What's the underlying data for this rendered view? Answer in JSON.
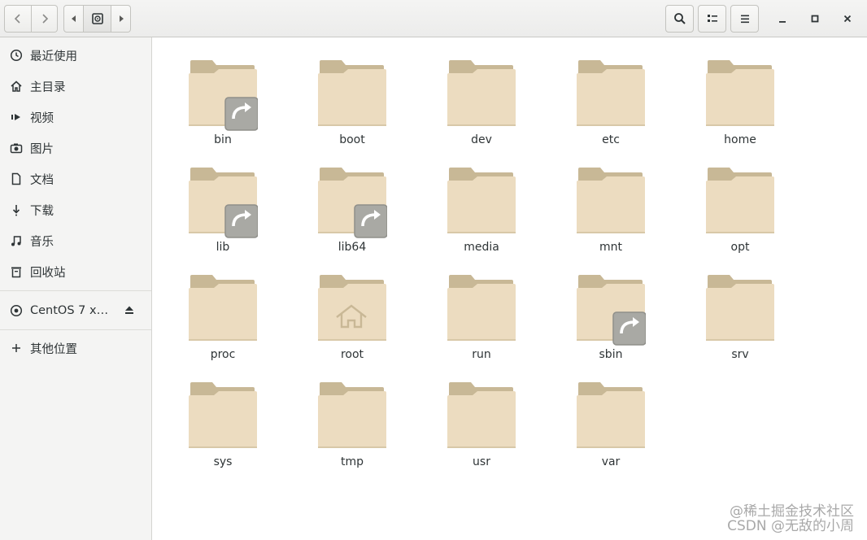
{
  "sidebar": {
    "items": [
      {
        "label": "最近使用",
        "icon": "clock-icon"
      },
      {
        "label": "主目录",
        "icon": "home-icon"
      },
      {
        "label": "视频",
        "icon": "video-icon"
      },
      {
        "label": "图片",
        "icon": "camera-icon"
      },
      {
        "label": "文档",
        "icon": "document-icon"
      },
      {
        "label": "下载",
        "icon": "download-icon"
      },
      {
        "label": "音乐",
        "icon": "music-icon"
      },
      {
        "label": "回收站",
        "icon": "trash-icon"
      }
    ],
    "device": {
      "label": "CentOS 7 x…",
      "icon": "disc-icon",
      "eject_icon": "eject-icon"
    },
    "other": {
      "label": "其他位置",
      "icon": "plus-icon"
    }
  },
  "folders": [
    {
      "name": "bin",
      "link": true,
      "home": false
    },
    {
      "name": "boot",
      "link": false,
      "home": false
    },
    {
      "name": "dev",
      "link": false,
      "home": false
    },
    {
      "name": "etc",
      "link": false,
      "home": false
    },
    {
      "name": "home",
      "link": false,
      "home": false
    },
    {
      "name": "lib",
      "link": true,
      "home": false
    },
    {
      "name": "lib64",
      "link": true,
      "home": false
    },
    {
      "name": "media",
      "link": false,
      "home": false
    },
    {
      "name": "mnt",
      "link": false,
      "home": false
    },
    {
      "name": "opt",
      "link": false,
      "home": false
    },
    {
      "name": "proc",
      "link": false,
      "home": false
    },
    {
      "name": "root",
      "link": false,
      "home": true
    },
    {
      "name": "run",
      "link": false,
      "home": false
    },
    {
      "name": "sbin",
      "link": true,
      "home": false
    },
    {
      "name": "srv",
      "link": false,
      "home": false
    },
    {
      "name": "sys",
      "link": false,
      "home": false
    },
    {
      "name": "tmp",
      "link": false,
      "home": false
    },
    {
      "name": "usr",
      "link": false,
      "home": false
    },
    {
      "name": "var",
      "link": false,
      "home": false
    }
  ],
  "watermark": {
    "line1": "@稀土掘金技术社区",
    "line2": "CSDN @无敌的小周"
  },
  "colors": {
    "folder_back": "#c8b896",
    "folder_front": "#ecdcc0",
    "link_badge": "#a9a9a4"
  }
}
